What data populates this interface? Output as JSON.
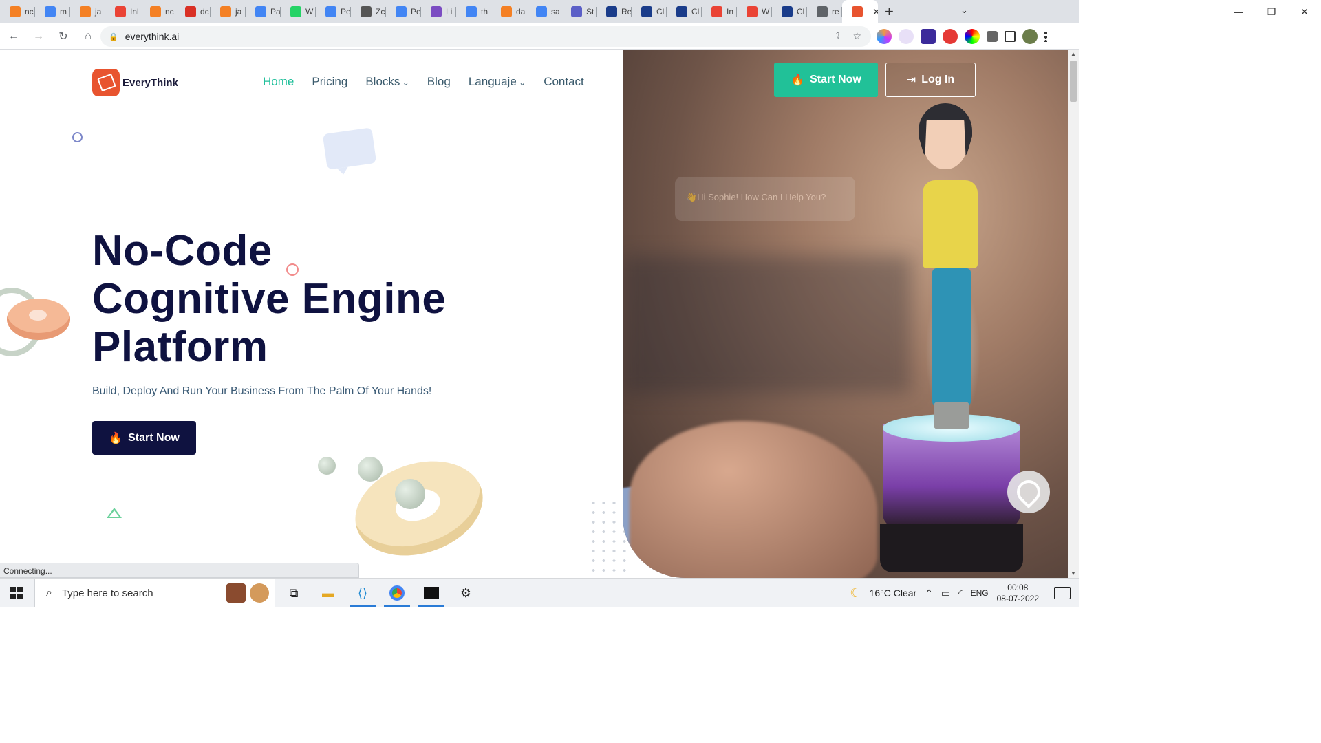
{
  "browser": {
    "tabs": [
      {
        "label": "nc",
        "icon": "stackoverflow-icon",
        "color": "#f48024"
      },
      {
        "label": "m",
        "icon": "google-icon",
        "color": "#4285f4"
      },
      {
        "label": "ja",
        "icon": "stackoverflow-icon",
        "color": "#f48024"
      },
      {
        "label": "Inl",
        "icon": "gmail-icon",
        "color": "#ea4335"
      },
      {
        "label": "nc",
        "icon": "stackoverflow-icon",
        "color": "#f48024"
      },
      {
        "label": "dc",
        "icon": "notion-icon",
        "color": "#d93025"
      },
      {
        "label": "ja",
        "icon": "stackoverflow-icon",
        "color": "#f48024"
      },
      {
        "label": "Pa",
        "icon": "google-icon",
        "color": "#4285f4"
      },
      {
        "label": "W",
        "icon": "whatsapp-icon",
        "color": "#25d366"
      },
      {
        "label": "Pe",
        "icon": "docs-icon",
        "color": "#4285f4"
      },
      {
        "label": "Zc",
        "icon": "wikipedia-icon",
        "color": "#555555"
      },
      {
        "label": "Pe",
        "icon": "docs-icon",
        "color": "#4285f4"
      },
      {
        "label": "Li",
        "icon": "pen-icon",
        "color": "#7b4cc2"
      },
      {
        "label": "th",
        "icon": "google-icon",
        "color": "#4285f4"
      },
      {
        "label": "da",
        "icon": "stackoverflow-icon",
        "color": "#f48024"
      },
      {
        "label": "sa",
        "icon": "google-icon",
        "color": "#4285f4"
      },
      {
        "label": "St",
        "icon": "teams-icon",
        "color": "#5b5fc7"
      },
      {
        "label": "Re",
        "icon": "bank-icon",
        "color": "#1a3c8a"
      },
      {
        "label": "Cl",
        "icon": "bank-icon",
        "color": "#1a3c8a"
      },
      {
        "label": "Cl",
        "icon": "bank-icon",
        "color": "#1a3c8a"
      },
      {
        "label": "In",
        "icon": "gmail-icon",
        "color": "#ea4335"
      },
      {
        "label": "W",
        "icon": "gmail-icon",
        "color": "#ea4335"
      },
      {
        "label": "Cl",
        "icon": "bank-icon",
        "color": "#1a3c8a"
      },
      {
        "label": "re",
        "icon": "globe-icon",
        "color": "#5f6368"
      }
    ],
    "active_tab_icon": "everythink-icon",
    "url": "everythink.ai",
    "status": "Connecting..."
  },
  "site": {
    "brand": "EveryThink",
    "nav": [
      {
        "label": "Home",
        "active": true
      },
      {
        "label": "Pricing"
      },
      {
        "label": "Blocks",
        "dropdown": true
      },
      {
        "label": "Blog"
      },
      {
        "label": "Languaje",
        "dropdown": true
      },
      {
        "label": "Contact"
      }
    ],
    "start_now": "Start Now",
    "log_in": "Log In",
    "hero_title_lines": [
      "No-Code",
      "Cognitive Engine",
      "Platform"
    ],
    "hero_subtitle": "Build, Deploy And Run Your Business From The Palm Of Your Hands!",
    "hero_cta": "Start Now",
    "assistant_bubble": "👋Hi Sophie! How Can I Help You?",
    "accent_color": "#21c198",
    "dark_color": "#0f1240"
  },
  "taskbar": {
    "search_placeholder": "Type here to search",
    "weather": "16°C  Clear",
    "lang": "ENG",
    "time": "00:08",
    "date": "08-07-2022"
  }
}
